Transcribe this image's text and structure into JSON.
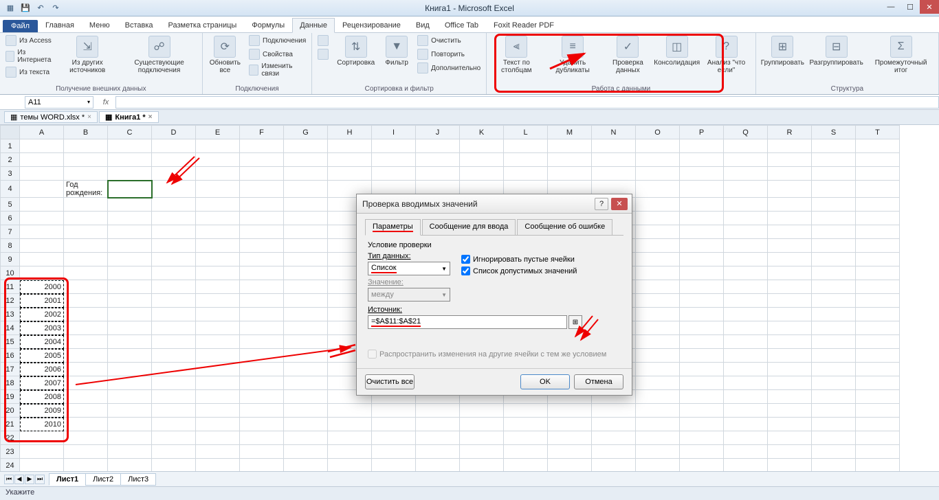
{
  "window": {
    "title": "Книга1 - Microsoft Excel"
  },
  "qat": {
    "save": "💾",
    "undo": "↶",
    "redo": "↷"
  },
  "ribbon_tabs": {
    "file": "Файл",
    "items": [
      "Главная",
      "Меню",
      "Вставка",
      "Разметка страницы",
      "Формулы",
      "Данные",
      "Рецензирование",
      "Вид",
      "Office Tab",
      "Foxit Reader PDF"
    ],
    "active": "Данные"
  },
  "ribbon": {
    "group1": {
      "access": "Из Access",
      "web": "Из Интернета",
      "text": "Из текста",
      "other": "Из других источников",
      "conn": "Существующие подключения",
      "label": "Получение внешних данных"
    },
    "group2": {
      "refresh": "Обновить все",
      "connections": "Подключения",
      "properties": "Свойства",
      "edit_links": "Изменить связи",
      "label": "Подключения"
    },
    "group3": {
      "sort_az": "A↓Z",
      "sort_za": "Z↓A",
      "sort": "Сортировка",
      "filter": "Фильтр",
      "clear": "Очистить",
      "reapply": "Повторить",
      "advanced": "Дополнительно",
      "label": "Сортировка и фильтр"
    },
    "group4": {
      "text_to_cols": "Текст по столбцам",
      "remove_dup": "Удалить дубликаты",
      "validation": "Проверка данных",
      "consolidate": "Консолидация",
      "whatif": "Анализ \"что если\"",
      "label": "Работа с данными"
    },
    "group5": {
      "group": "Группировать",
      "ungroup": "Разгруппировать",
      "subtotal": "Промежуточный итог",
      "label": "Структура"
    }
  },
  "namebox": "A11",
  "workbook_tabs": {
    "t1": "темы WORD.xlsx *",
    "t2": "Книга1 *"
  },
  "columns": [
    "A",
    "B",
    "C",
    "D",
    "E",
    "F",
    "G",
    "H",
    "I",
    "J",
    "K",
    "L",
    "M",
    "N",
    "O",
    "P",
    "Q",
    "R",
    "S",
    "T"
  ],
  "cell_b4": "Год рождения:",
  "years": [
    "2000",
    "2001",
    "2002",
    "2003",
    "2004",
    "2005",
    "2006",
    "2007",
    "2008",
    "2009",
    "2010"
  ],
  "sheet_tabs": [
    "Лист1",
    "Лист2",
    "Лист3"
  ],
  "status": "Укажите",
  "dialog": {
    "title": "Проверка вводимых значений",
    "tabs": {
      "t1": "Параметры",
      "t2": "Сообщение для ввода",
      "t3": "Сообщение об ошибке"
    },
    "section_label": "Условие проверки",
    "type_label": "Тип данных:",
    "type_value": "Список",
    "ignore_blank": "Игнорировать пустые ячейки",
    "in_cell_dropdown": "Список допустимых значений",
    "value_label": "Значение:",
    "value_value": "между",
    "source_label": "Источник:",
    "source_value": "=$A$11:$A$21",
    "propagate": "Распространить изменения на другие ячейки с тем же условием",
    "clear_all": "Очистить все",
    "ok": "OK",
    "cancel": "Отмена"
  }
}
